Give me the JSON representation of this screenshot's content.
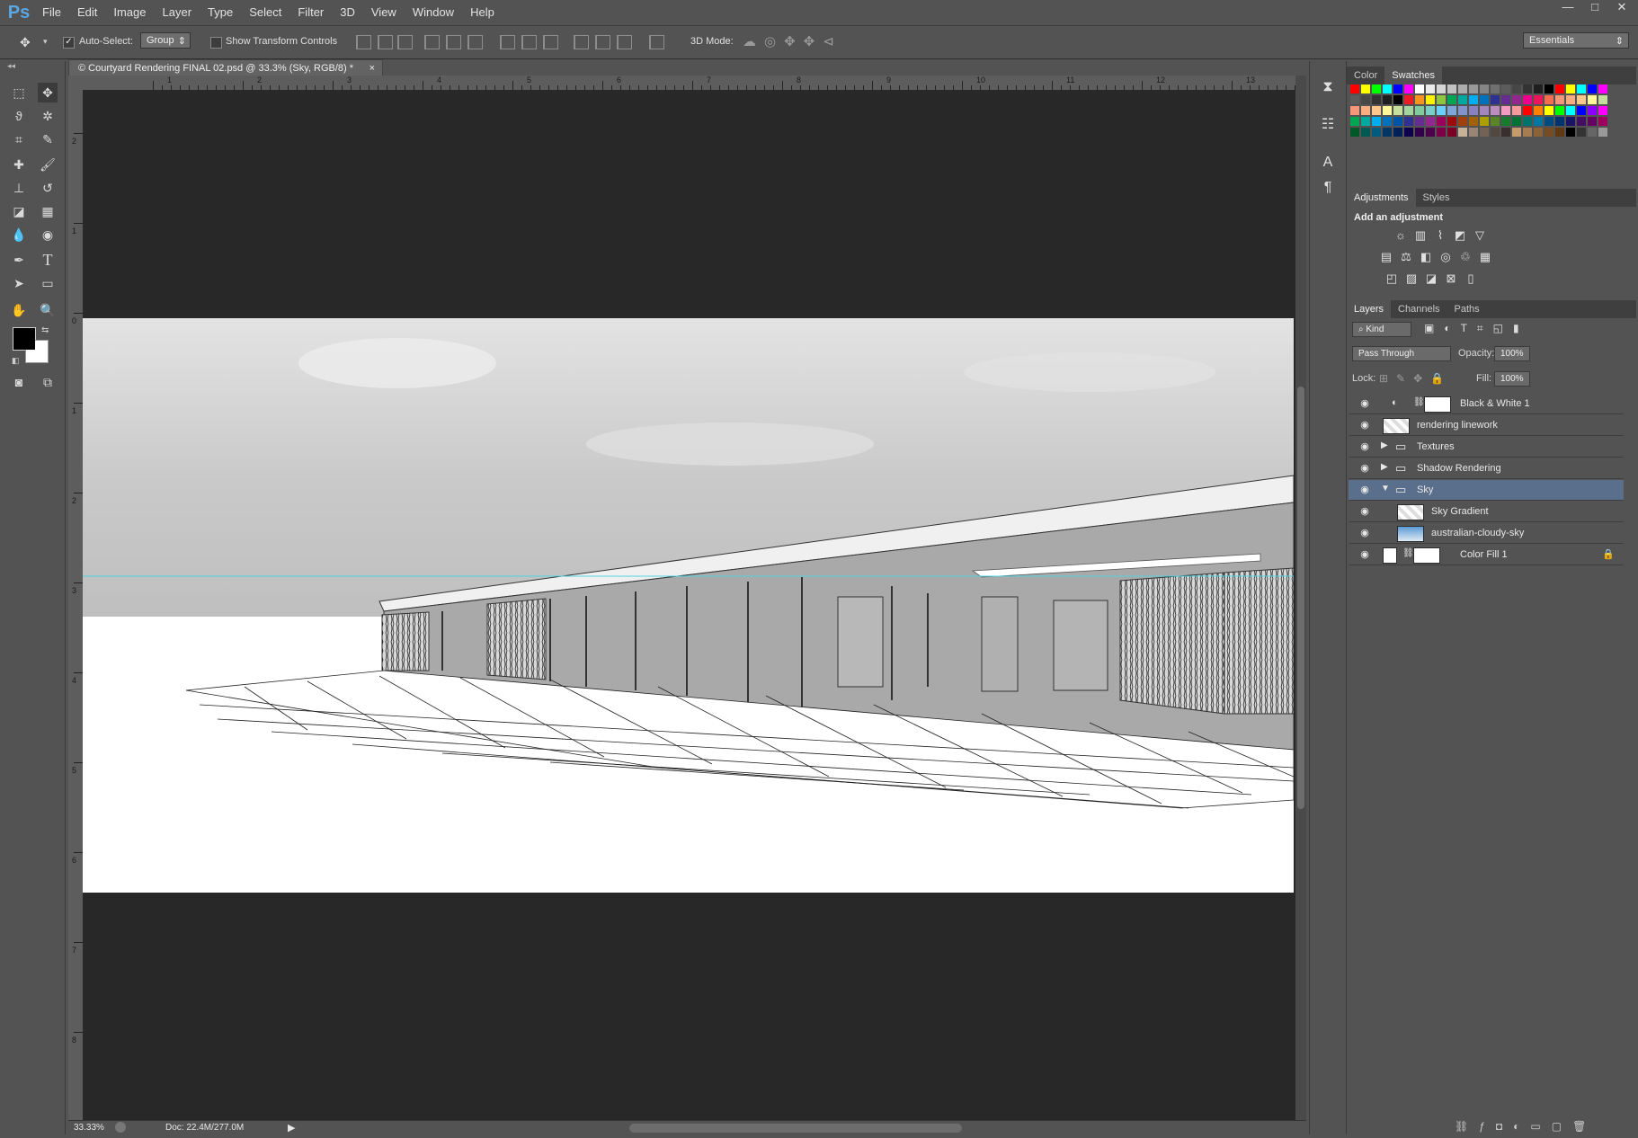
{
  "menubar": {
    "logo": "Ps",
    "items": [
      "File",
      "Edit",
      "Image",
      "Layer",
      "Type",
      "Select",
      "Filter",
      "3D",
      "View",
      "Window",
      "Help"
    ],
    "window_controls": [
      "—",
      "□",
      "✕"
    ]
  },
  "options": {
    "auto_select_label": "Auto-Select:",
    "auto_select_value": "Group",
    "show_transform_label": "Show Transform Controls",
    "mode_3d_label": "3D Mode:",
    "workspace": "Essentials"
  },
  "document": {
    "tab_title": "© Courtyard Rendering FINAL 02.psd @ 33.3% (Sky, RGB/8) *",
    "close": "×"
  },
  "ruler": {
    "h_ticks": [
      "1",
      "2",
      "3",
      "4",
      "5",
      "6",
      "7",
      "8",
      "9",
      "10",
      "11",
      "12",
      "13"
    ],
    "v_ticks": [
      "2",
      "1",
      "0",
      "1",
      "2",
      "3",
      "4",
      "5",
      "6",
      "7",
      "8"
    ]
  },
  "status": {
    "zoom": "33.33%",
    "doc_info": "Doc: 22.4M/277.0M"
  },
  "panels": {
    "color_tab": "Color",
    "swatches_tab": "Swatches",
    "adjustments_tab": "Adjustments",
    "styles_tab": "Styles",
    "add_adjustment": "Add an adjustment",
    "layers_tab": "Layers",
    "channels_tab": "Channels",
    "paths_tab": "Paths",
    "kind_filter": "Kind",
    "blend_mode": "Pass Through",
    "opacity_label": "Opacity:",
    "opacity_value": "100%",
    "lock_label": "Lock:",
    "fill_label": "Fill:",
    "fill_value": "100%"
  },
  "layers": [
    {
      "name": "Black & White 1",
      "type": "adjustment"
    },
    {
      "name": "rendering linework",
      "type": "smart"
    },
    {
      "name": "Textures",
      "type": "group-collapsed"
    },
    {
      "name": "Shadow Rendering",
      "type": "group-collapsed"
    },
    {
      "name": "Sky",
      "type": "group-expanded",
      "selected": true
    },
    {
      "name": "Sky Gradient",
      "type": "child"
    },
    {
      "name": "australian-cloudy-sky",
      "type": "child-smart"
    },
    {
      "name": "Color Fill 1",
      "type": "fill",
      "locked": true
    }
  ],
  "colors": {
    "selection": "#5a6f8c",
    "guide": "#4fd3e0",
    "foreground": "#000000",
    "background": "#ffffff"
  }
}
